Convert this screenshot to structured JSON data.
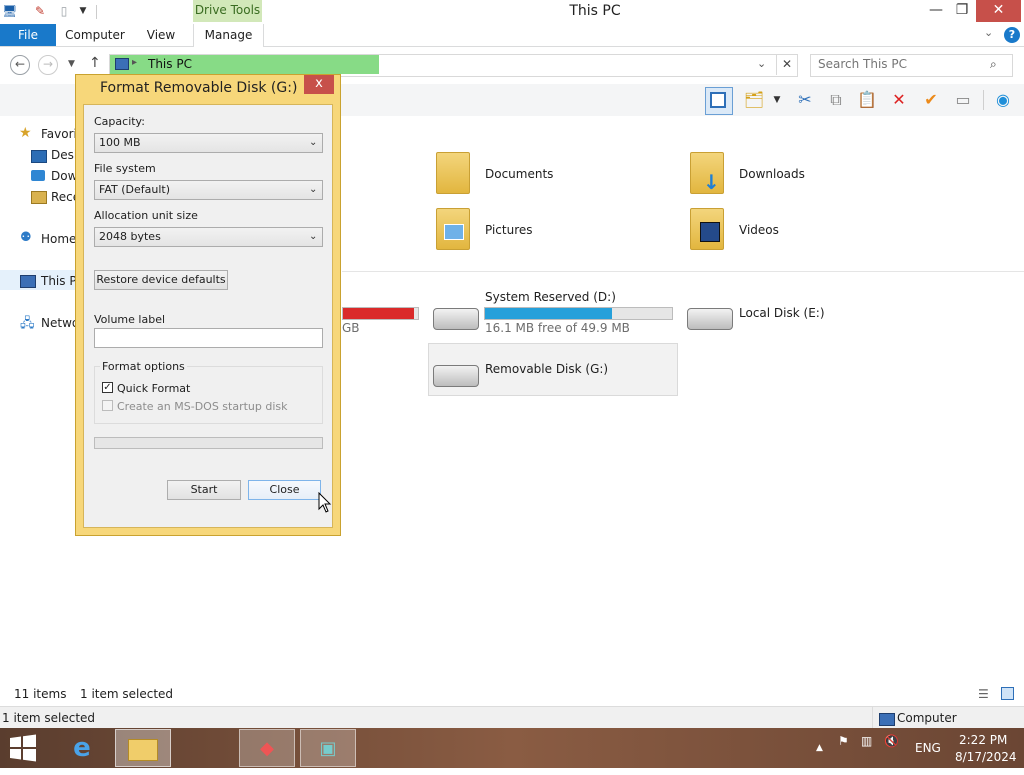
{
  "window": {
    "title": "This PC",
    "contextual_tab_header": "Drive Tools",
    "controls": {
      "minimize": "—",
      "maximize": "❐",
      "close": "✕"
    }
  },
  "ribbon": {
    "file_tab": "File",
    "tabs": [
      "Computer",
      "View",
      "Manage"
    ],
    "help": "?"
  },
  "address": {
    "location": "This PC",
    "search_placeholder": "Search This PC"
  },
  "navigation": {
    "items": [
      {
        "label": "Favorit",
        "icon": "star-icon"
      },
      {
        "label": "Desk",
        "icon": "desktop-icon"
      },
      {
        "label": "Dow",
        "icon": "downloads-icon"
      },
      {
        "label": "Rece",
        "icon": "recent-places-icon"
      },
      {
        "label": "Home",
        "icon": "homegroup-icon"
      },
      {
        "label": "This P",
        "icon": "computer-icon"
      },
      {
        "label": "Netwo",
        "icon": "network-icon"
      }
    ]
  },
  "folders": [
    {
      "name": "Documents",
      "icon": "documents-folder-icon"
    },
    {
      "name": "Downloads",
      "icon": "downloads-folder-icon"
    },
    {
      "name": "Pictures",
      "icon": "pictures-folder-icon"
    },
    {
      "name": "Videos",
      "icon": "videos-folder-icon"
    }
  ],
  "drives": [
    {
      "name": "",
      "free_text": "GB",
      "usage_fraction": 0.95,
      "bar_color": "#da2a2a"
    },
    {
      "name": "System Reserved (D:)",
      "free_text": "16.1 MB free of 49.9 MB",
      "usage_fraction": 0.68,
      "bar_color": "#26a0da"
    },
    {
      "name": "Local Disk (E:)",
      "free_text": "",
      "usage_fraction": null
    },
    {
      "name": "Removable Disk (G:)",
      "free_text": "",
      "usage_fraction": null,
      "selected": true
    }
  ],
  "status": {
    "item_count": "11 items",
    "selection": "1 item selected",
    "bottom_selection": "1 item selected",
    "location": "Computer"
  },
  "dialog": {
    "title": "Format Removable Disk (G:)",
    "close": "x",
    "capacity_label": "Capacity:",
    "capacity_value": "100 MB",
    "filesystem_label": "File system",
    "filesystem_value": "FAT (Default)",
    "allocation_label": "Allocation unit size",
    "allocation_value": "2048 bytes",
    "restore_button": "Restore device defaults",
    "volume_label": "Volume label",
    "volume_value": "",
    "format_options_label": "Format options",
    "quick_format_label": "Quick Format",
    "quick_format_checked": true,
    "msdos_label": "Create an MS-DOS startup disk",
    "msdos_checked": false,
    "progress": 0,
    "start_button": "Start",
    "close_button": "Close"
  },
  "taskbar": {
    "language": "ENG",
    "time": "2:22 PM",
    "date": "8/17/2024"
  },
  "colors": {
    "accent": "#1979ca",
    "dialog_frame": "#f7d77a",
    "address_highlight": "#87db86",
    "close_red": "#c7504a"
  }
}
